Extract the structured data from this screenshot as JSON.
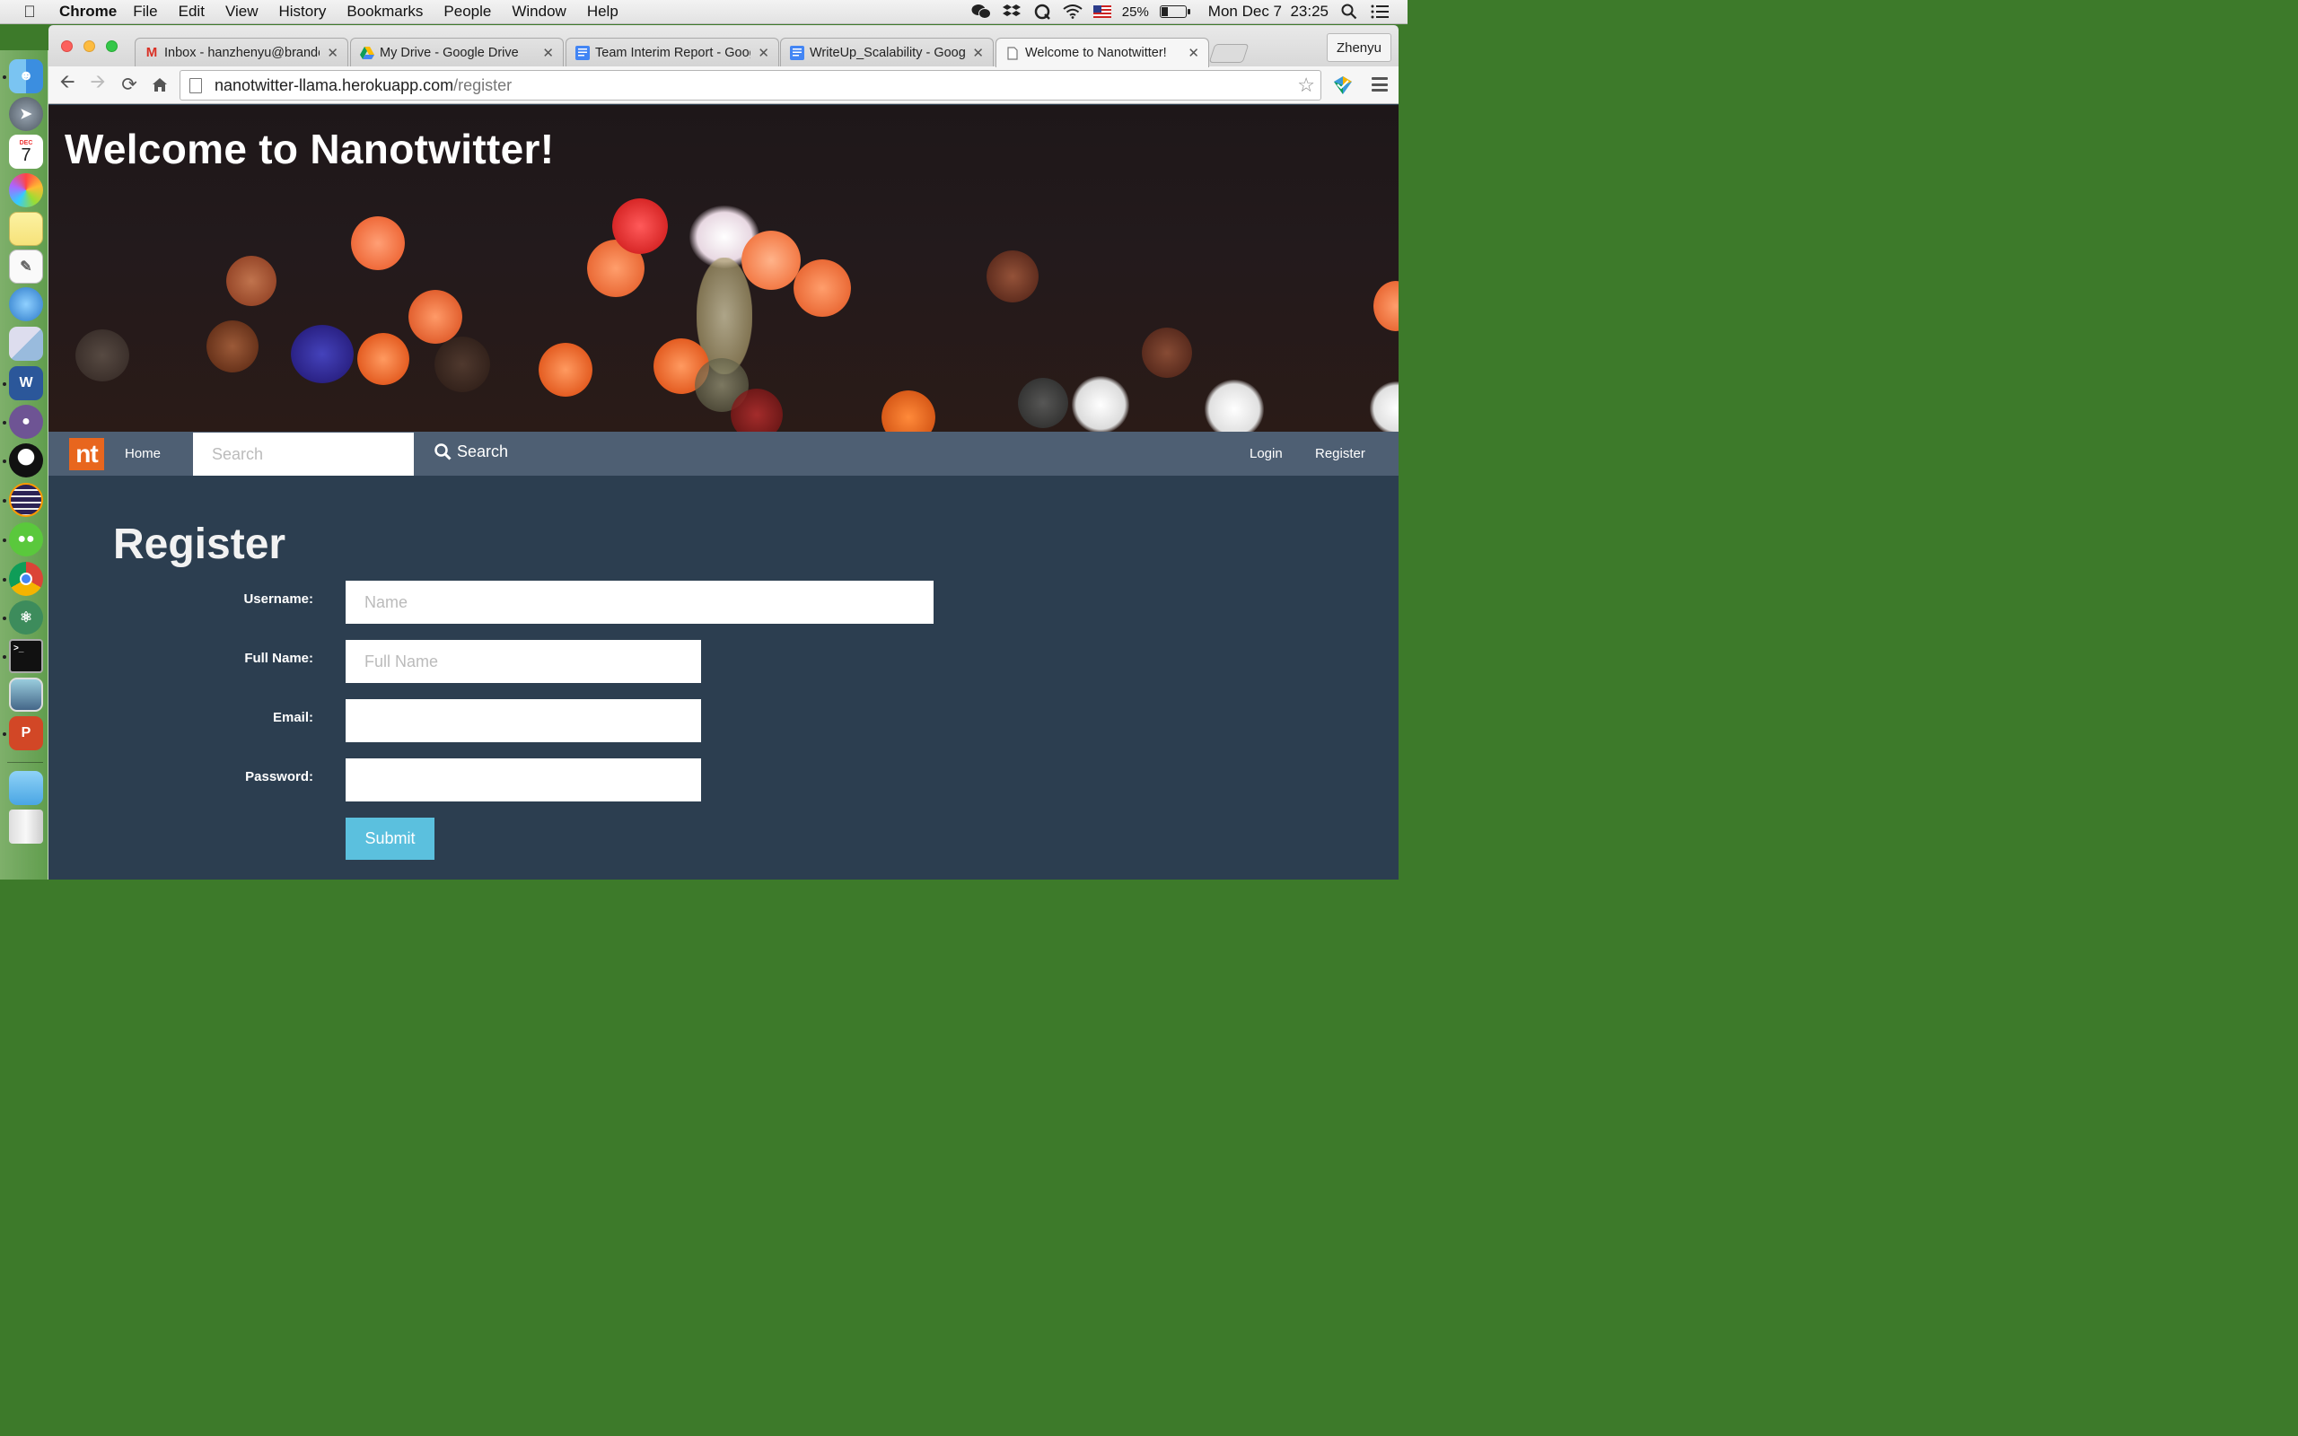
{
  "menubar": {
    "app_name": "Chrome",
    "items": [
      "File",
      "Edit",
      "View",
      "History",
      "Bookmarks",
      "People",
      "Window",
      "Help"
    ],
    "battery_percent": "25%",
    "battery_level": 0.25,
    "clock": "Mon Dec 7  23:25"
  },
  "browser": {
    "tabs": [
      {
        "title": "Inbox - hanzhenyu@brandeis.edu",
        "icon": "gmail-icon"
      },
      {
        "title": "My Drive - Google Drive",
        "icon": "google-drive-icon"
      },
      {
        "title": "Team Interim Report - Google Docs",
        "icon": "google-docs-icon"
      },
      {
        "title": "WriteUp_Scalability - Google Docs",
        "icon": "google-docs-icon"
      },
      {
        "title": "Welcome to Nanotwitter!",
        "icon": "page-icon"
      }
    ],
    "profile_name": "Zhenyu",
    "url_domain": "nanotwitter-llama.herokuapp.com",
    "url_path": "/register"
  },
  "dock": {
    "calendar_month": "DEC",
    "calendar_day": "7"
  },
  "site": {
    "hero_title": "Welcome to Nanotwitter!",
    "logo_text": "nt",
    "nav_home": "Home",
    "search_placeholder": "Search",
    "search_button": "Search",
    "nav_login": "Login",
    "nav_register": "Register"
  },
  "form": {
    "title": "Register",
    "username_label": "Username:",
    "username_placeholder": "Name",
    "fullname_label": "Full Name:",
    "fullname_placeholder": "Full Name",
    "email_label": "Email:",
    "password_label": "Password:",
    "submit_label": "Submit"
  },
  "colors": {
    "page_bg": "#2c3e50",
    "navbar_bg": "#4e5f73",
    "logo_orange": "#e8661e",
    "submit_blue": "#5bc0de"
  }
}
